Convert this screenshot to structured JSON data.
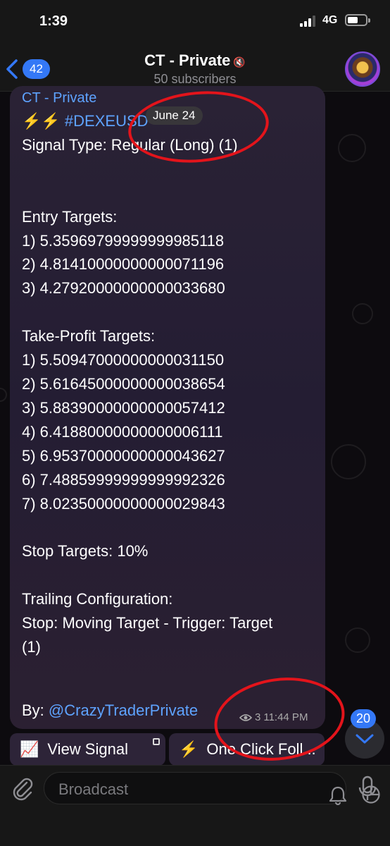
{
  "status_bar": {
    "time": "1:39",
    "network": "4G"
  },
  "header": {
    "back_count": "42",
    "title": "CT - Private",
    "subtitle": "50 subscribers"
  },
  "message": {
    "sender": "CT - Private",
    "date_pill": "June 24",
    "line1_emoji": "⚡⚡",
    "hashtag": "#DEXEUSD",
    "body": "Signal Type: Regular (Long) (1)\n\n\nEntry Targets:\n1) 5.35969799999999985118\n2) 4.81410000000000071196\n3) 4.27920000000000033680\n\nTake-Profit Targets:\n1) 5.50947000000000031150\n2) 5.61645000000000038654\n3) 5.88390000000000057412\n4) 6.41880000000000006111\n5) 6.95370000000000043627\n6) 7.48859999999999992326\n7) 8.02350000000000029843\n\nStop Targets: 10%\n\nTrailing Configuration:\nStop: Moving Target - Trigger: Target\n(1)",
    "by_label": "By:",
    "mention": "@CrazyTraderPrivate",
    "views": "3",
    "time": "11:44 PM"
  },
  "buttons": {
    "view_signal_emoji": "📈",
    "view_signal": "View Signal",
    "one_click_emoji": "⚡",
    "one_click": "One Click Foll..."
  },
  "unread_badge": "20",
  "input": {
    "placeholder": "Broadcast"
  },
  "colors": {
    "accent": "#3478f6",
    "link": "#5ea3ff",
    "annotation": "#e3141b"
  }
}
